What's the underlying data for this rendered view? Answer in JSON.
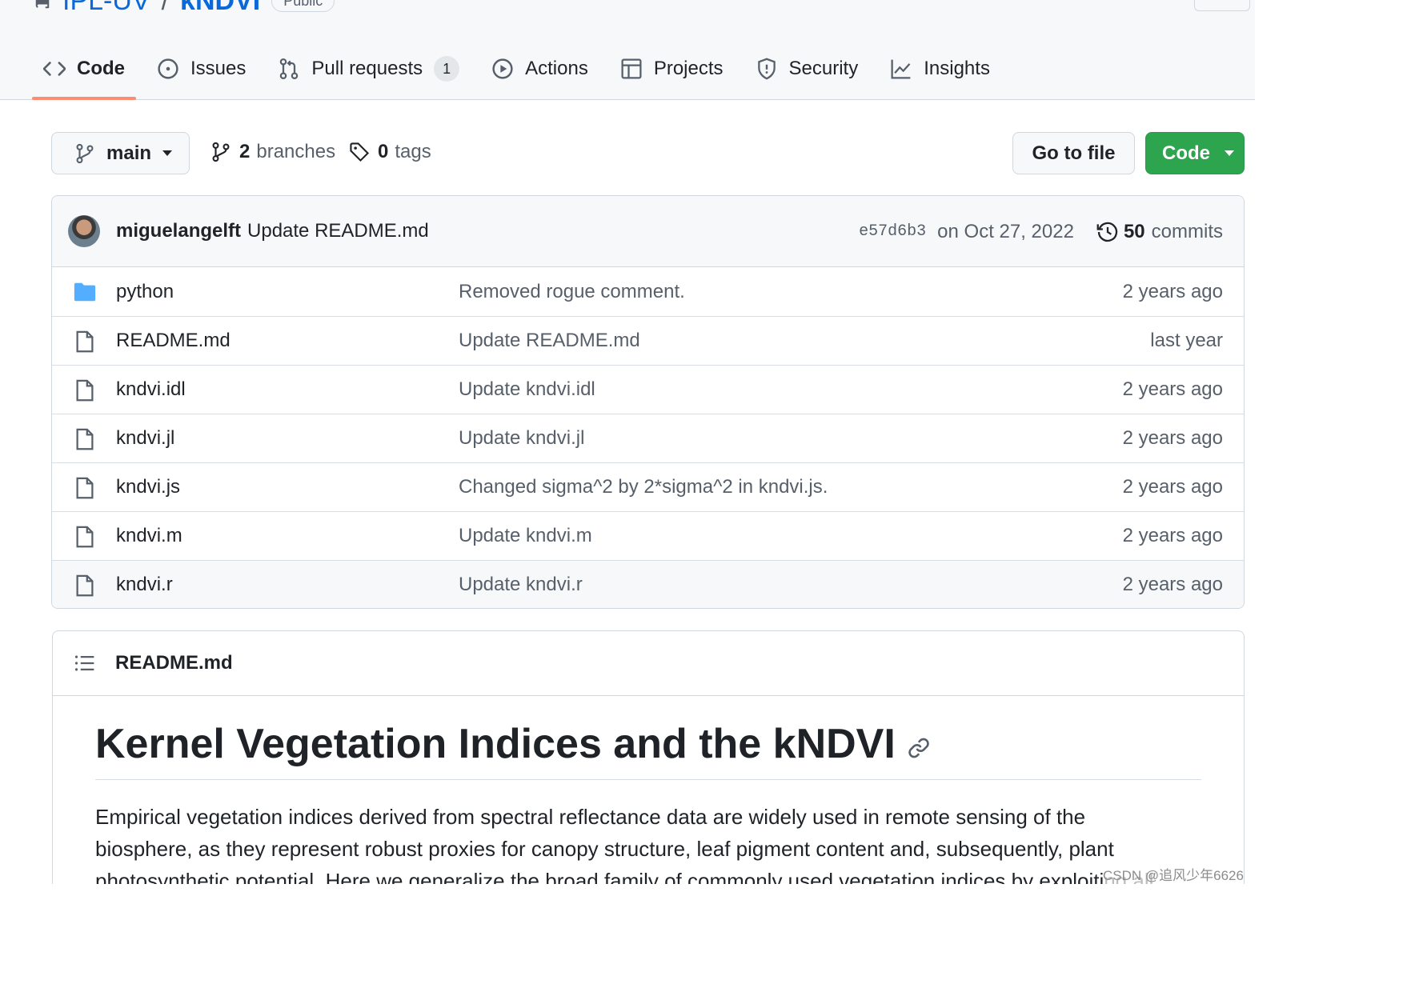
{
  "repo": {
    "owner": "IPL-UV",
    "separator": "/",
    "name": "kNDVI",
    "visibility": "Public"
  },
  "tabs": [
    {
      "label": "Code",
      "icon": "code-icon",
      "active": true
    },
    {
      "label": "Issues",
      "icon": "issue-icon"
    },
    {
      "label": "Pull requests",
      "icon": "pull-request-icon",
      "count": "1"
    },
    {
      "label": "Actions",
      "icon": "play-icon"
    },
    {
      "label": "Projects",
      "icon": "table-icon"
    },
    {
      "label": "Security",
      "icon": "shield-icon"
    },
    {
      "label": "Insights",
      "icon": "graph-icon"
    }
  ],
  "branch": {
    "name": "main",
    "branches_count": "2",
    "branches_label": "branches",
    "tags_count": "0",
    "tags_label": "tags"
  },
  "buttons": {
    "goto_file": "Go to file",
    "code": "Code"
  },
  "commit": {
    "author": "miguelangelft",
    "message": "Update README.md",
    "sha": "e57d6b3",
    "date": "on Oct 27, 2022",
    "commits_count": "50",
    "commits_label": "commits"
  },
  "files": [
    {
      "type": "dir",
      "name": "python",
      "message": "Removed rogue comment.",
      "age": "2 years ago"
    },
    {
      "type": "file",
      "name": "README.md",
      "message": "Update README.md",
      "age": "last year"
    },
    {
      "type": "file",
      "name": "kndvi.idl",
      "message": "Update kndvi.idl",
      "age": "2 years ago"
    },
    {
      "type": "file",
      "name": "kndvi.jl",
      "message": "Update kndvi.jl",
      "age": "2 years ago"
    },
    {
      "type": "file",
      "name": "kndvi.js",
      "message": "Changed sigma^2 by 2*sigma^2 in kndvi.js.",
      "age": "2 years ago"
    },
    {
      "type": "file",
      "name": "kndvi.m",
      "message": "Update kndvi.m",
      "age": "2 years ago"
    },
    {
      "type": "file",
      "name": "kndvi.r",
      "message": "Update kndvi.r",
      "age": "2 years ago"
    }
  ],
  "readme": {
    "filename": "README.md",
    "title": "Kernel Vegetation Indices and the kNDVI",
    "paragraph": "Empirical vegetation indices derived from spectral reflectance data are widely used in remote sensing of the biosphere, as they represent robust proxies for canopy structure, leaf pigment content and, subsequently, plant photosynthetic potential. Here we generalize the broad family of commonly used vegetation indices by exploiting all"
  },
  "watermark": "CSDN @追风少年6626",
  "colors": {
    "link": "#0969da",
    "active_tab_underline": "#fd8c73",
    "code_button": "#2da44e",
    "folder": "#54aeff"
  }
}
